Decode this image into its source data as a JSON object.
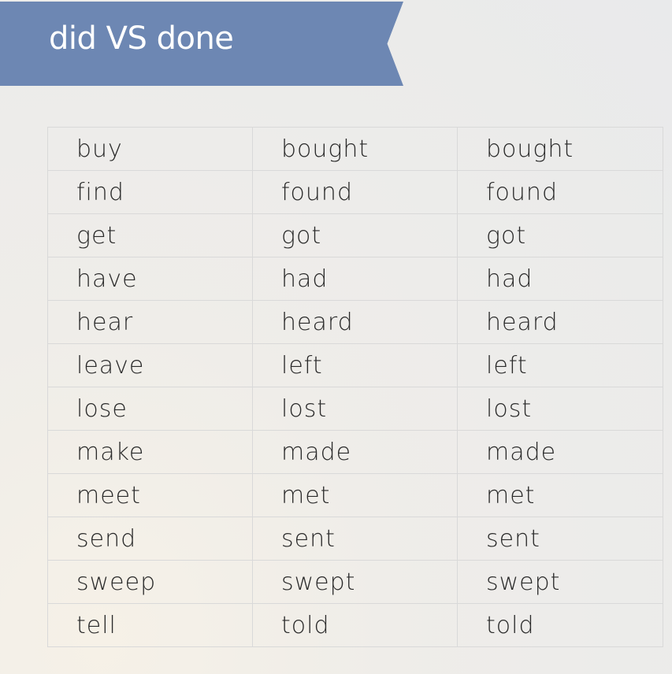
{
  "title": "did VS done",
  "rows": [
    [
      "buy",
      "bought",
      "bought"
    ],
    [
      "find",
      "found",
      "found"
    ],
    [
      "get",
      "got",
      "got"
    ],
    [
      "have",
      "had",
      "had"
    ],
    [
      "hear",
      "heard",
      "heard"
    ],
    [
      "leave",
      "left",
      "left"
    ],
    [
      "lose",
      "lost",
      "lost"
    ],
    [
      "make",
      "made",
      "made"
    ],
    [
      "meet",
      "met",
      "met"
    ],
    [
      "send",
      "sent",
      "sent"
    ],
    [
      "sweep",
      "swept",
      "swept"
    ],
    [
      "tell",
      "told",
      "told"
    ]
  ],
  "colors": {
    "banner": "#6d87b3",
    "title_text": "#ffffff",
    "cell_text": "#2a2a2a",
    "grid_line": "#d9d9d9"
  }
}
